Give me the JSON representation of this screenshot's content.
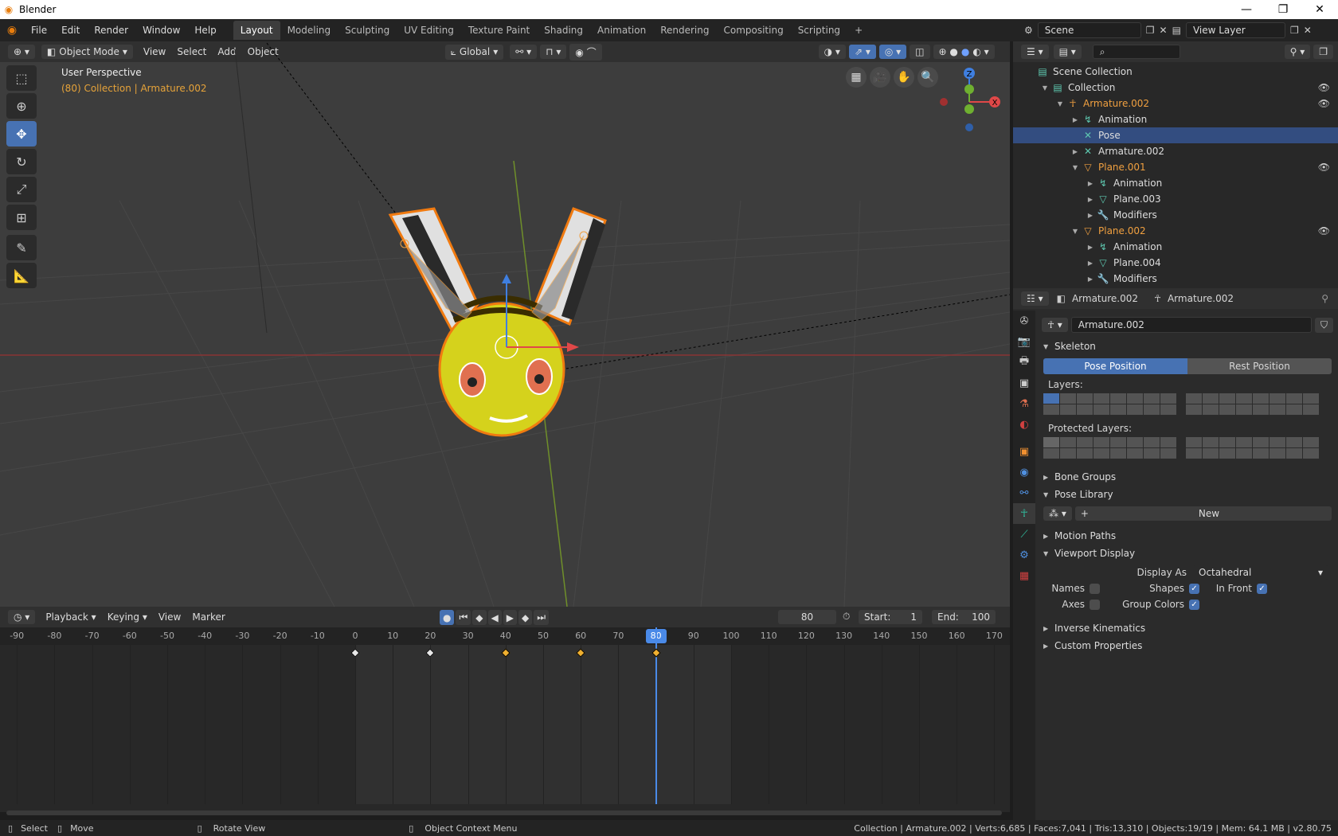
{
  "window": {
    "title": "Blender",
    "minimize": "—",
    "maximize": "❐",
    "close": "✕"
  },
  "menus": [
    "File",
    "Edit",
    "Render",
    "Window",
    "Help"
  ],
  "workspaces": [
    "Layout",
    "Modeling",
    "Sculpting",
    "UV Editing",
    "Texture Paint",
    "Shading",
    "Animation",
    "Rendering",
    "Compositing",
    "Scripting"
  ],
  "active_workspace": "Layout",
  "scene": {
    "label": "Scene",
    "view_layer": "View Layer"
  },
  "viewport": {
    "mode": "Object Mode",
    "menus": [
      "View",
      "Select",
      "Add",
      "Object"
    ],
    "orientation": "Global",
    "info_title": "User Perspective",
    "info_sub": "(80) Collection | Armature.002",
    "gizmo": {
      "x": "X",
      "y": "Y",
      "z": "Z"
    }
  },
  "timeline": {
    "menus": [
      "Playback",
      "Keying",
      "View",
      "Marker"
    ],
    "current_frame": "80",
    "start_label": "Start:",
    "start": "1",
    "end_label": "End:",
    "end": "100",
    "ticks": [
      -90,
      -80,
      -70,
      -60,
      -50,
      -40,
      -30,
      -20,
      -10,
      0,
      10,
      20,
      30,
      40,
      50,
      60,
      70,
      80,
      90,
      100,
      110,
      120,
      130,
      140,
      150,
      160,
      170
    ],
    "keyframes": [
      {
        "frame": 0,
        "selected": false
      },
      {
        "frame": 20,
        "selected": false
      },
      {
        "frame": 40,
        "selected": true
      },
      {
        "frame": 60,
        "selected": true
      },
      {
        "frame": 80,
        "selected": true
      }
    ]
  },
  "outliner": {
    "rows": [
      {
        "label": "Scene Collection",
        "depth": 0,
        "icon": "▤",
        "color": "#ddd",
        "arrow": "",
        "eye": false,
        "sel": false
      },
      {
        "label": "Collection",
        "depth": 1,
        "icon": "▤",
        "color": "#ddd",
        "arrow": "▼",
        "eye": true,
        "sel": false
      },
      {
        "label": "Armature.002",
        "depth": 2,
        "icon": "☥",
        "color": "#f0a040",
        "arrow": "▼",
        "eye": true,
        "sel": false
      },
      {
        "label": "Animation",
        "depth": 3,
        "icon": "↯",
        "color": "#ddd",
        "arrow": "▶",
        "eye": false,
        "sel": false
      },
      {
        "label": "Pose",
        "depth": 3,
        "icon": "✕",
        "color": "#ddd",
        "arrow": "",
        "eye": false,
        "sel": true
      },
      {
        "label": "Armature.002",
        "depth": 3,
        "icon": "✕",
        "color": "#ddd",
        "arrow": "▶",
        "eye": false,
        "sel": false
      },
      {
        "label": "Plane.001",
        "depth": 3,
        "icon": "▽",
        "color": "#f0a040",
        "arrow": "▼",
        "eye": true,
        "sel": false
      },
      {
        "label": "Animation",
        "depth": 4,
        "icon": "↯",
        "color": "#ddd",
        "arrow": "▶",
        "eye": false,
        "sel": false
      },
      {
        "label": "Plane.003",
        "depth": 4,
        "icon": "▽",
        "color": "#ddd",
        "arrow": "▶",
        "eye": false,
        "sel": false
      },
      {
        "label": "Modifiers",
        "depth": 4,
        "icon": "🔧",
        "color": "#ddd",
        "arrow": "▶",
        "eye": false,
        "sel": false
      },
      {
        "label": "Plane.002",
        "depth": 3,
        "icon": "▽",
        "color": "#f0a040",
        "arrow": "▼",
        "eye": true,
        "sel": false
      },
      {
        "label": "Animation",
        "depth": 4,
        "icon": "↯",
        "color": "#ddd",
        "arrow": "▶",
        "eye": false,
        "sel": false
      },
      {
        "label": "Plane.004",
        "depth": 4,
        "icon": "▽",
        "color": "#ddd",
        "arrow": "▶",
        "eye": false,
        "sel": false
      },
      {
        "label": "Modifiers",
        "depth": 4,
        "icon": "🔧",
        "color": "#ddd",
        "arrow": "▶",
        "eye": false,
        "sel": false
      }
    ]
  },
  "properties": {
    "breadcrumb_object": "Armature.002",
    "breadcrumb_data": "Armature.002",
    "data_name": "Armature.002",
    "skeleton": "Skeleton",
    "pose_position": "Pose Position",
    "rest_position": "Rest Position",
    "layers": "Layers:",
    "protected_layers": "Protected Layers:",
    "bone_groups": "Bone Groups",
    "pose_library": "Pose Library",
    "new": "New",
    "motion_paths": "Motion Paths",
    "viewport_display": "Viewport Display",
    "display_as_label": "Display As",
    "display_as": "Octahedral",
    "names": "Names",
    "shapes": "Shapes",
    "in_front": "In Front",
    "axes": "Axes",
    "group_colors": "Group Colors",
    "inverse_kinematics": "Inverse Kinematics",
    "custom_properties": "Custom Properties"
  },
  "status": {
    "select": "Select",
    "move": "Move",
    "rotate": "Rotate View",
    "context": "Object Context Menu",
    "stats": "Collection | Armature.002 | Verts:6,685 | Faces:7,041 | Tris:13,310 | Objects:19/19 | Mem: 64.1 MB | v2.80.75"
  }
}
